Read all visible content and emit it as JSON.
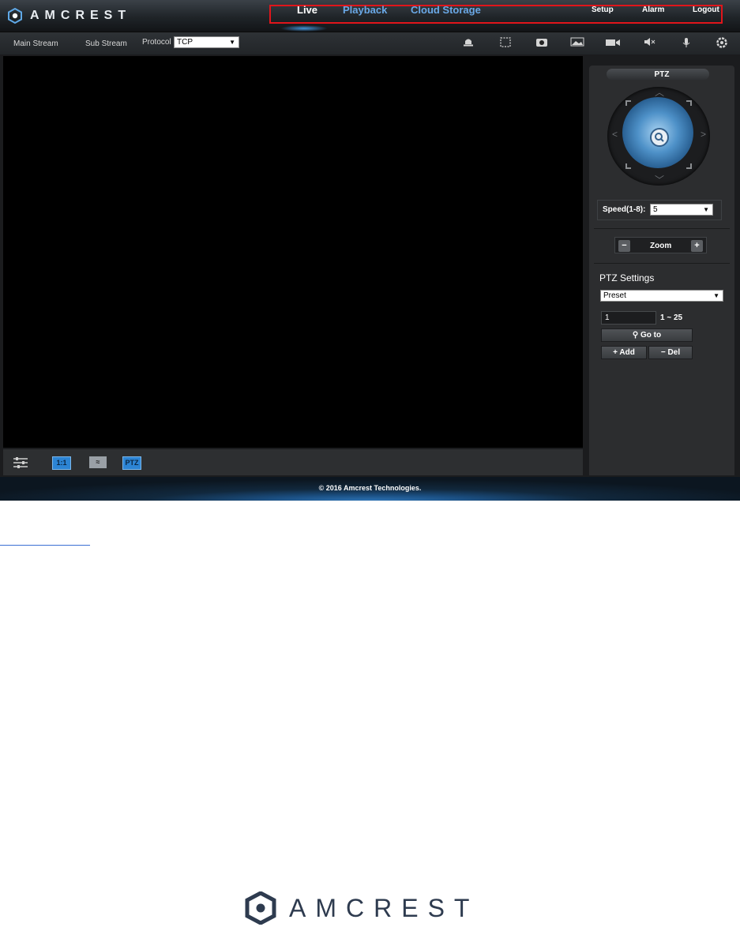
{
  "brand": {
    "name": "AMCREST"
  },
  "nav": {
    "primary": [
      {
        "label": "Live",
        "active": true
      },
      {
        "label": "Playback",
        "active": false
      },
      {
        "label": "Cloud Storage",
        "active": false
      }
    ],
    "secondary": [
      "Setup",
      "Alarm",
      "Logout"
    ]
  },
  "toolbar": {
    "main_stream": "Main Stream",
    "sub_stream": "Sub Stream",
    "protocol_label": "Protocol",
    "protocol_value": "TCP",
    "icons": [
      "alarm-bell-icon",
      "fullscreen-icon",
      "snapshot-camera-icon",
      "image-adjust-icon",
      "record-camera-icon",
      "mute-speaker-icon",
      "microphone-icon",
      "settings-gear-icon"
    ]
  },
  "video_bar": {
    "icons": [
      "adjust-sliders-icon",
      "original-size-icon",
      "fluency-icon",
      "ptz-toggle-icon"
    ],
    "labels": {
      "original_size": "1:1",
      "ptz": "PTZ"
    }
  },
  "ptz": {
    "title": "PTZ",
    "speed_label": "Speed(1-8):",
    "speed_value": "5",
    "zoom_label": "Zoom",
    "settings_title": "PTZ Settings",
    "settings_mode": "Preset",
    "preset_value": "1",
    "preset_range": "1 ~ 25",
    "goto_label": "Go to",
    "add_label": "Add",
    "del_label": "Del"
  },
  "footer": {
    "copyright": "© 2016 Amcrest Technologies."
  },
  "colors": {
    "active_nav": "#ffffff",
    "inactive_nav": "#6aa8e6",
    "highlight_box": "#e0151b",
    "brand_dark": "#2e3b4f"
  }
}
